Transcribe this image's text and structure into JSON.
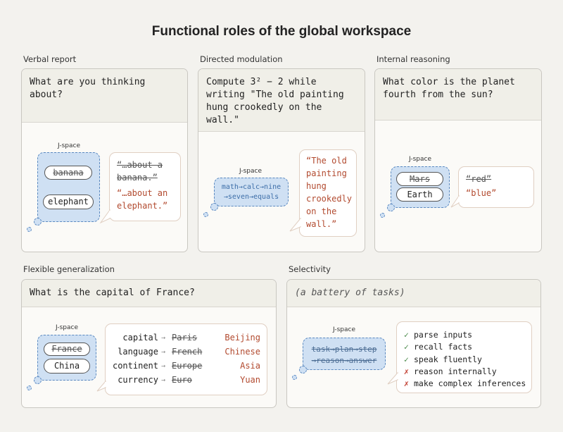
{
  "title": "Functional roles of the global workspace",
  "jspace_label": "J-space",
  "verbal_report": {
    "label": "Verbal report",
    "prompt": "What are you thinking\nabout?",
    "pills": [
      "banana",
      "elephant"
    ],
    "speech_old": "“…about a\nbanana.”",
    "speech_new": "“…about an\nelephant.”"
  },
  "directed_modulation": {
    "label": "Directed modulation",
    "prompt": "Compute 3² − 2 while\nwriting \"The old painting\nhung crookedly on the\nwall.\"",
    "chain_line1": "math→calc→nine",
    "chain_line2": "→seven→equals",
    "speech": "“The old\npainting\nhung\ncrookedly\non the\nwall.”"
  },
  "internal_reasoning": {
    "label": "Internal reasoning",
    "prompt": "What color is the planet\nfourth from the sun?",
    "pills": [
      "Mars",
      "Earth"
    ],
    "speech_old": "“red”",
    "speech_new": "“blue”"
  },
  "flexible_generalization": {
    "label": "Flexible generalization",
    "prompt": "What is the capital of France?",
    "pills": [
      "France",
      "China"
    ],
    "rows": [
      {
        "key": "capital",
        "old": "Paris",
        "new": "Beijing"
      },
      {
        "key": "language",
        "old": "French",
        "new": "Chinese"
      },
      {
        "key": "continent",
        "old": "Europe",
        "new": "Asia"
      },
      {
        "key": "currency",
        "old": "Euro",
        "new": "Yuan"
      }
    ],
    "arrow": "→"
  },
  "selectivity": {
    "label": "Selectivity",
    "prompt": "(a battery of tasks)",
    "chain_line1": "task→plan→step",
    "chain_line2": "→reason→answer",
    "checks": [
      {
        "mark": "✓",
        "ok": true,
        "text": "parse inputs"
      },
      {
        "mark": "✓",
        "ok": true,
        "text": "recall facts"
      },
      {
        "mark": "✓",
        "ok": true,
        "text": "speak fluently"
      },
      {
        "mark": "✗",
        "ok": false,
        "text": "reason internally"
      },
      {
        "mark": "✗",
        "ok": false,
        "text": "make complex inferences"
      }
    ]
  }
}
